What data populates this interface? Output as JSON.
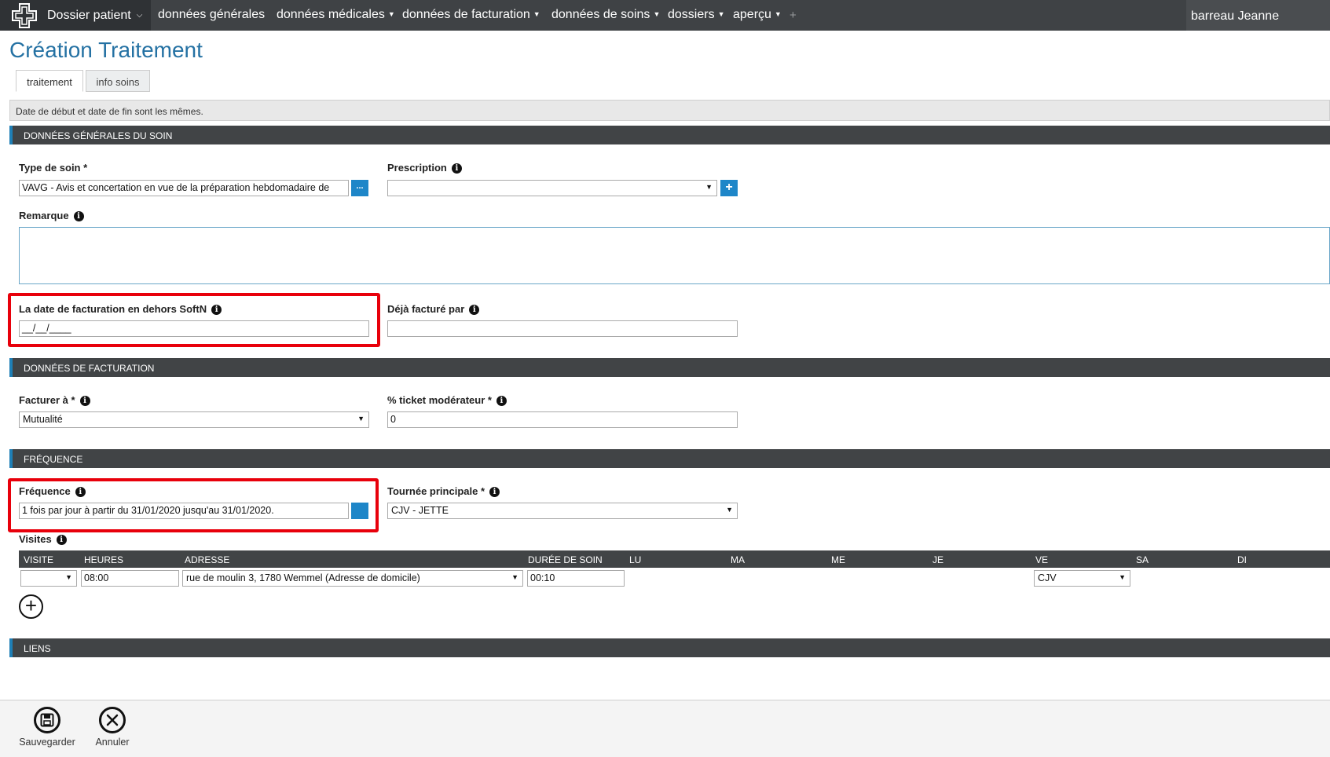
{
  "topnav": {
    "brand": "Dossier patient",
    "items": [
      {
        "label": "données générales",
        "dropdown": false
      },
      {
        "label": "données médicales",
        "dropdown": true
      },
      {
        "label": "données de facturation",
        "dropdown": true
      },
      {
        "label": "données de soins",
        "dropdown": true
      },
      {
        "label": "dossiers",
        "dropdown": true
      },
      {
        "label": "aperçu",
        "dropdown": true
      }
    ],
    "plus": "+",
    "user": "barreau Jeanne"
  },
  "page": {
    "title": "Création Traitement"
  },
  "tabs": [
    {
      "label": "traitement",
      "active": true
    },
    {
      "label": "info soins",
      "active": false
    }
  ],
  "alert": "Date de début et date de fin sont les mêmes.",
  "sections": {
    "general": "DONNÉES GÉNÉRALES DU SOIN",
    "billing": "DONNÉES DE FACTURATION",
    "frequency": "FRÉQUENCE",
    "links": "LIENS"
  },
  "fields": {
    "type_soin": {
      "label": "Type de soin *",
      "value": "VAVG - Avis et concertation en vue de la préparation hebdomadaire de",
      "button": "..."
    },
    "prescription": {
      "label": "Prescription",
      "value": "",
      "button": "+"
    },
    "remarque": {
      "label": "Remarque",
      "value": ""
    },
    "date_facturation": {
      "label": "La date de facturation en dehors SoftN",
      "value": "__/__/____"
    },
    "deja_facture": {
      "label": "Déjà facturé par",
      "value": ""
    },
    "facturer_a": {
      "label": "Facturer à *",
      "value": "Mutualité"
    },
    "ticket": {
      "label": "% ticket modérateur *",
      "value": "0"
    },
    "frequence": {
      "label": "Fréquence",
      "value": "1 fois par jour à partir du 31/01/2020 jusqu'au 31/01/2020."
    },
    "tournee": {
      "label": "Tournée principale *",
      "value": "CJV - JETTE"
    },
    "visites": {
      "label": "Visites"
    }
  },
  "visits_table": {
    "columns": [
      "VISITE",
      "HEURES",
      "ADRESSE",
      "DURÉE DE SOIN",
      "LU",
      "MA",
      "ME",
      "JE",
      "VE",
      "SA",
      "DI"
    ],
    "row": {
      "visite": "",
      "heures": "08:00",
      "adresse": "rue de moulin 3, 1780 Wemmel (Adresse de domicile)",
      "duree": "00:10",
      "ve": "CJV"
    },
    "add": "+"
  },
  "footer": {
    "save": "Sauvegarder",
    "cancel": "Annuler"
  },
  "colors": {
    "nav_bg": "#3f4245",
    "title": "#2471a3",
    "accent": "#1e86c8",
    "highlight": "#e8000b"
  }
}
